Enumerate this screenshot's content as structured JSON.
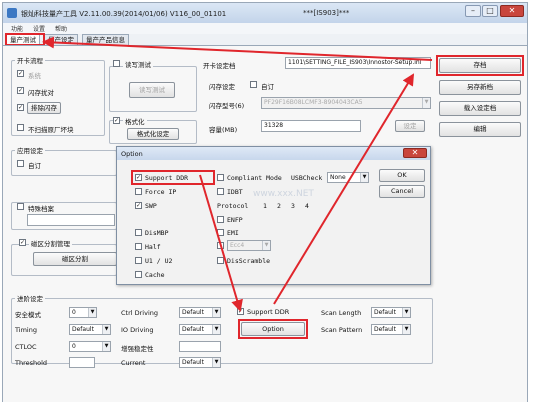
{
  "window": {
    "title": "银灿科技量产工具 V2.11.00.39(2014/01/06)   V116_00_01101",
    "title_right": "***[IS903]***",
    "min_label": "–",
    "max_label": "□",
    "close_label": "✕"
  },
  "menu": [
    "功能",
    "设置",
    "帮助"
  ],
  "tabs": [
    "量产测试",
    "量产设定",
    "量产产品信息"
  ],
  "top": {
    "card_flow_label": "开卡流程",
    "flow_items": [
      {
        "label": "系统",
        "checked": true,
        "dim": true
      },
      {
        "label": "闪存扰对",
        "checked": true,
        "dim": false
      },
      {
        "label": "排除闪存",
        "checked": true,
        "dim": false
      },
      {
        "label": "不扫描原厂坏块",
        "checked": false,
        "dim": false
      }
    ],
    "read_write_test_label": "读写测试",
    "read_write_test_button": "读写测试",
    "format_label": "格式化",
    "format_button": "格式化设定",
    "card_setting_label": "开卡设定档",
    "card_setting_path": "1101\\SETTING_FILE_IS903\\Innostor-Setup.ini",
    "flash_setting_label": "闪存设定",
    "auto_label": "自订",
    "flash_model_label": "闪存型号(6)",
    "flash_model_value": "PF29F16B08LCMF3-8904043CA5",
    "capacity_label": "容量(MB)",
    "capacity_value": "31328",
    "setting_button": "设定"
  },
  "right_buttons": [
    "存档",
    "另存新档",
    "载入设定档",
    "编辑"
  ],
  "mid": {
    "app_setting_label": "应用设定",
    "custom_label": "自订",
    "special_label": "特殊档案",
    "partition_label": "磁区分割管理",
    "partition_button": "磁区分割"
  },
  "dialog": {
    "title": "Option",
    "close_label": "✕",
    "col1": [
      {
        "label": "Support DDR",
        "checked": true
      },
      {
        "label": "Force IP",
        "checked": false
      },
      {
        "label": "SWP",
        "checked": true
      },
      {
        "label": "DisMBP",
        "checked": false
      },
      {
        "label": "Half",
        "checked": false
      },
      {
        "label": "U1 / U2",
        "checked": false
      },
      {
        "label": "Cache",
        "checked": false
      }
    ],
    "col2": [
      {
        "label": "Compliant Mode",
        "checked": false
      },
      {
        "label": "IDBT",
        "checked": false
      },
      {
        "label": "ENFP",
        "checked": false
      },
      {
        "label": "EMI",
        "checked": false
      },
      {
        "label": "DisScramble",
        "checked": false
      }
    ],
    "usb_check_label": "USBCheck",
    "usb_check_value": "None",
    "protocol_label": "Protocol",
    "protocol_values": [
      "1",
      "2",
      "3",
      "4"
    ],
    "ecc_value": "Ecc4",
    "ok_button": "OK",
    "cancel_button": "Cancel"
  },
  "bottom": {
    "advanced_label": "进阶设定",
    "rows": [
      [
        {
          "label": "安全模式",
          "value": "0"
        },
        {
          "label": "Ctrl Driving",
          "value": "Default"
        },
        {
          "label": "Scan Length",
          "value": "Default"
        }
      ],
      [
        {
          "label": "Timing",
          "value": "Default"
        },
        {
          "label": "IO Driving",
          "value": "Default"
        },
        {
          "label": "Scan Pattern",
          "value": "Default"
        }
      ],
      [
        {
          "label": "CTLOC",
          "value": "0"
        },
        {
          "label": "增强稳定性",
          "value": ""
        }
      ],
      [
        {
          "label": "Threshold",
          "value": ""
        },
        {
          "label": "Current",
          "value": "Default"
        }
      ]
    ],
    "support_ddr_label": "Support DDR",
    "option_button": "Option"
  },
  "watermark": "www.xxx.NET",
  "colors": {
    "highlight": "#e0262c",
    "titlebar": "#c3d4ea"
  }
}
